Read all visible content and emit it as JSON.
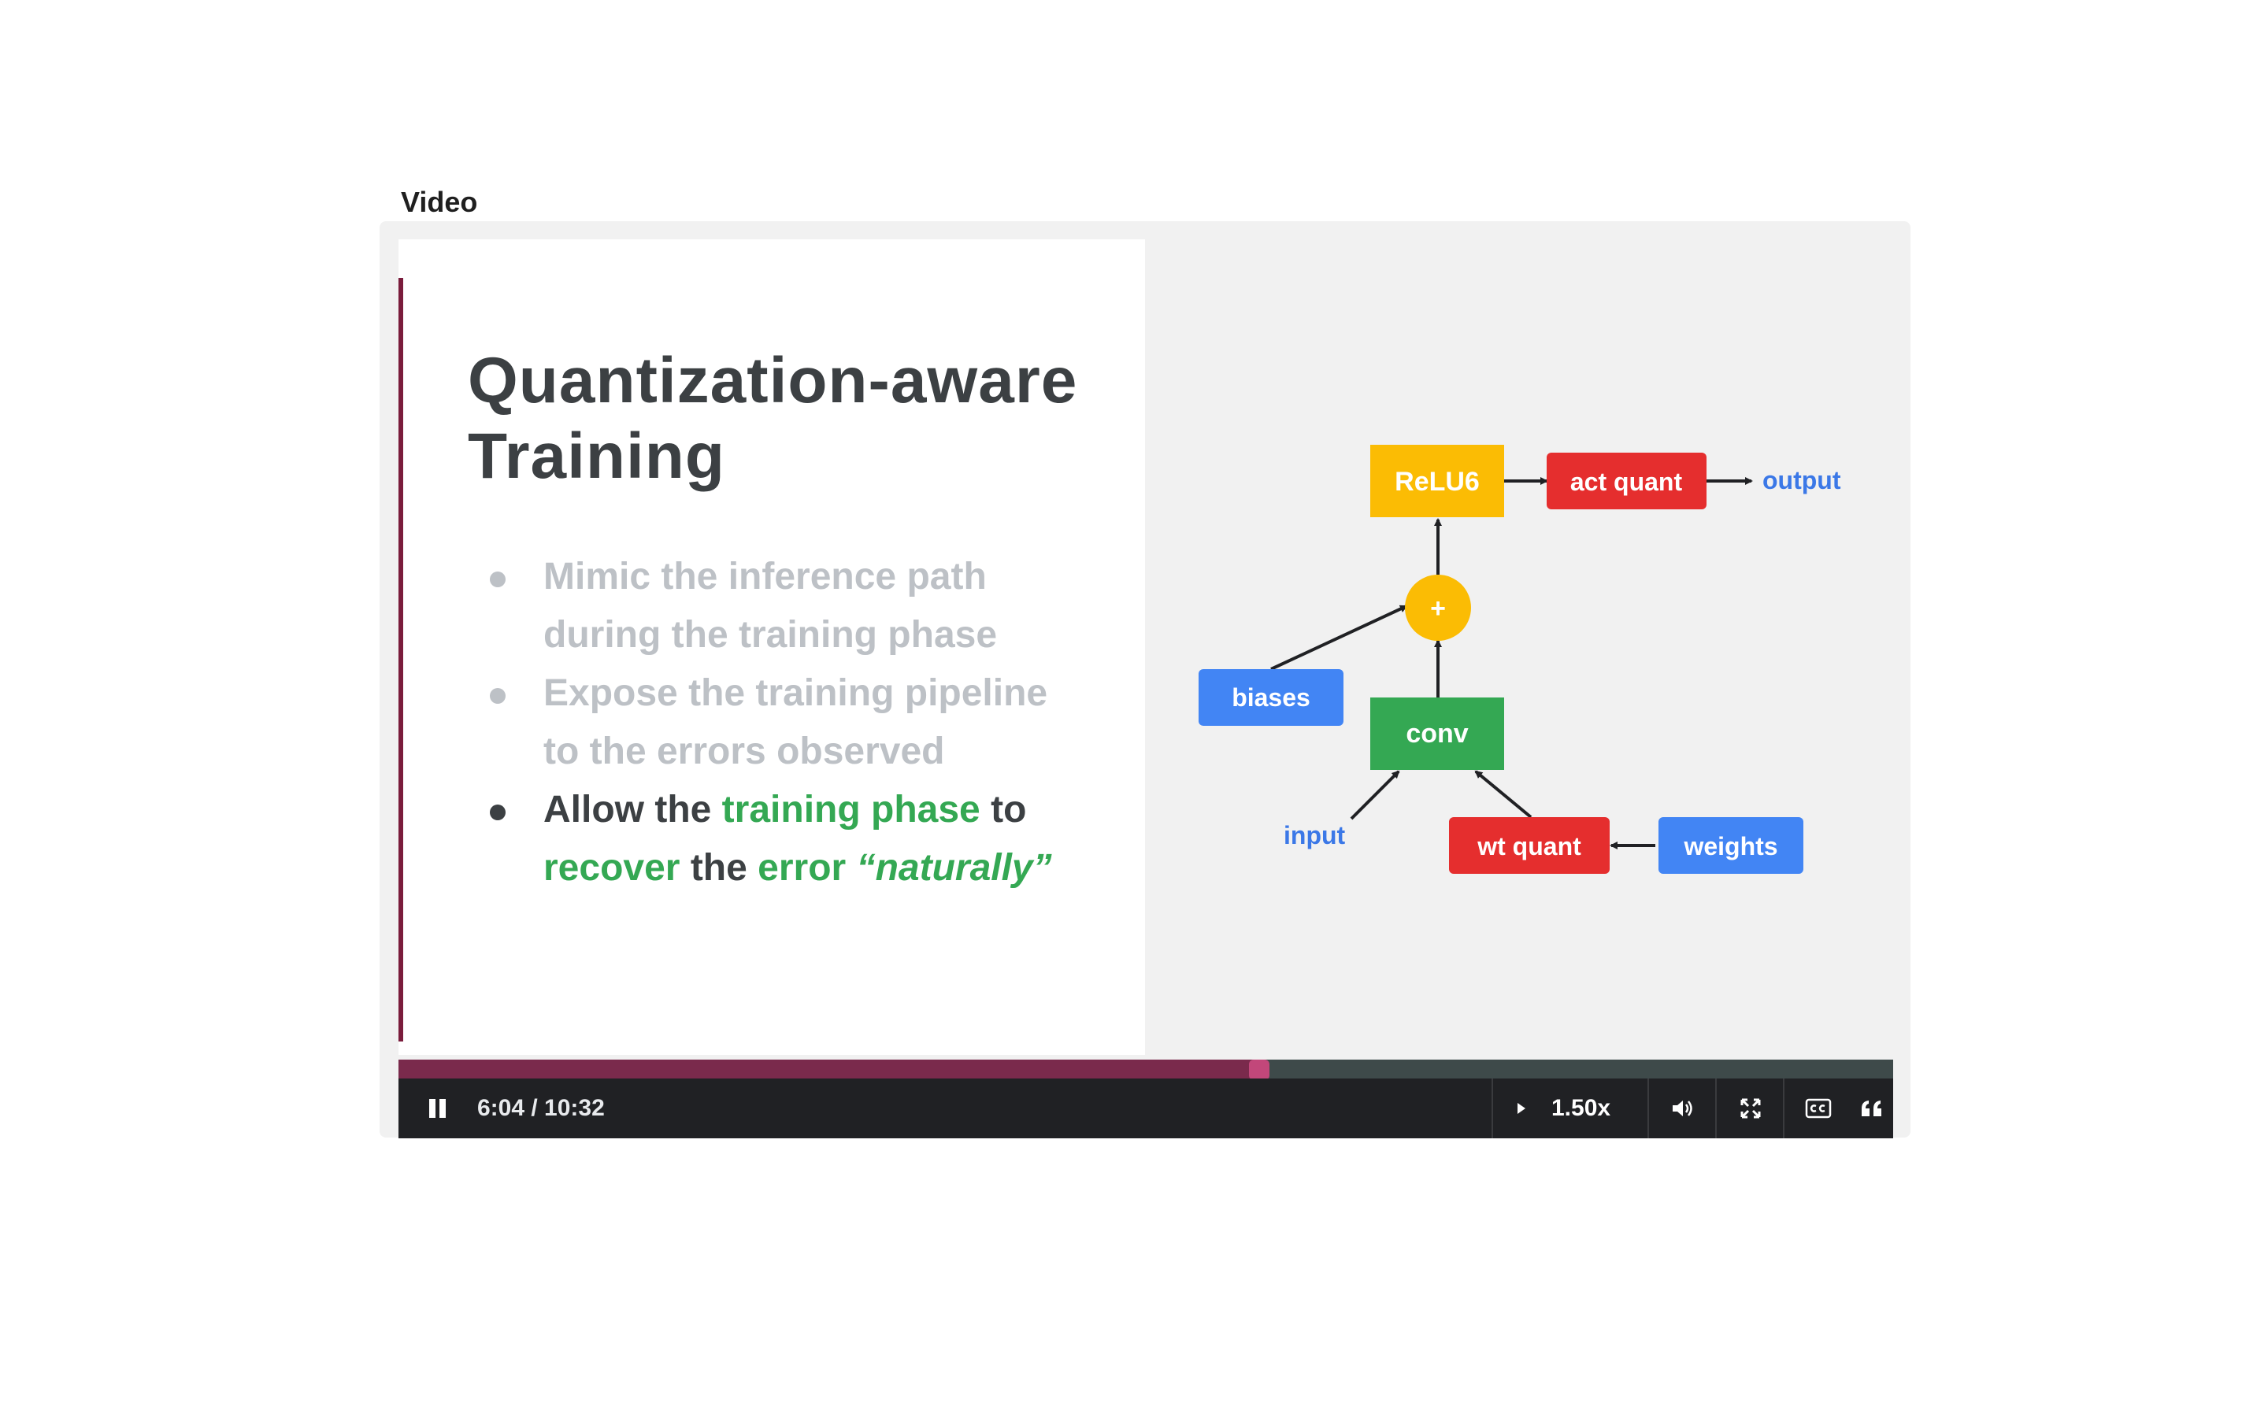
{
  "section": {
    "label": "Video"
  },
  "slide": {
    "title_line1": "Quantization-aware",
    "title_line2": "Training",
    "bullets": [
      {
        "segments": [
          "Mimic the inference path",
          "during the training phase"
        ]
      },
      {
        "segments": [
          "Expose the training pipeline",
          "to the errors observed"
        ]
      },
      {
        "w1": "Allow the",
        "w2": "training phase",
        "w3": "to",
        "w4": "recover",
        "w5": "the",
        "w6": "error",
        "w7": "“naturally”"
      }
    ]
  },
  "diagram": {
    "nodes": {
      "relu6": "ReLU6",
      "act_quant": "act quant",
      "output": "output",
      "plus": "+",
      "biases": "biases",
      "conv": "conv",
      "input": "input",
      "wt_quant": "wt quant",
      "weights": "weights"
    },
    "colors": {
      "yellow": "#fbbc04",
      "red": "#e52e2e",
      "blue": "#4285f4",
      "green": "#34a853",
      "label_blue": "#3b78e7"
    }
  },
  "player": {
    "time": "6:04 / 10:32",
    "progress_fraction": 0.5759,
    "speed": "1.50x",
    "icons": {
      "pause": "pause-icon",
      "speed": "play-triangle-icon",
      "volume": "volume-icon",
      "fullscreen": "fullscreen-icon",
      "captions": "captions-icon",
      "transcript": "quote-icon"
    },
    "colors": {
      "progress_fill": "#7a2a4c",
      "thumb": "#c2477a",
      "track": "#3e4a4a",
      "bar": "#202124"
    }
  }
}
